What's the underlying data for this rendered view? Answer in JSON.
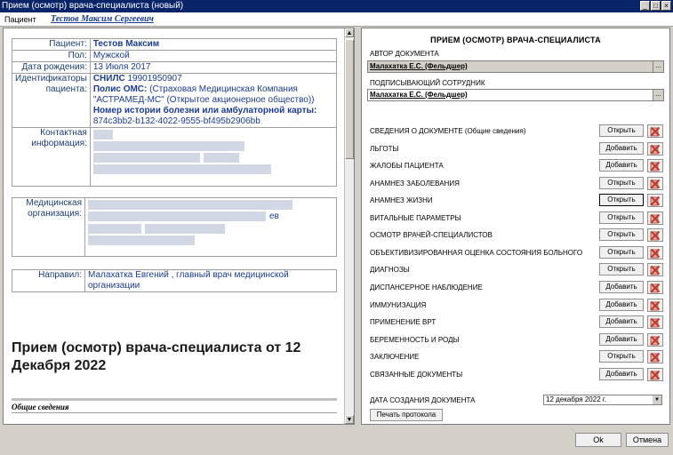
{
  "window": {
    "title": "Прием (осмотр) врача-специалиста (новый)",
    "controls": [
      "_",
      "□",
      "×"
    ]
  },
  "patient_bar": {
    "label": "Пациент",
    "name": "Тестов Максим Сергеевич"
  },
  "patient_card": {
    "patient_label": "Пациент:",
    "patient_value": "Тестов Максим",
    "sex_label": "Пол:",
    "sex_value": "Мужской",
    "dob_label": "Дата рождения:",
    "dob_value": "13 Июля 2017",
    "ids_label": "Идентификаторы пациента:",
    "snils_label": "СНИЛС",
    "snils_value": "19901950907",
    "oms_label": "Полис ОМС:",
    "oms_value": "(Страховая Медицинская Компания \"АСТРАМЕД-МС\" (Открытое акционерное общество))",
    "history_label": "Номер истории болезни или амбулаторной карты:",
    "history_value": "874c3bb2-b132-4022-9555-bf495b2906bb",
    "contact_label": "Контактная информация:",
    "org_label": "Медицинская организация:",
    "org_fragment": "ев",
    "referrer_label": "Направил:",
    "referrer_value": "Малахатка Евгений , главный врач медицинской организации"
  },
  "document": {
    "title": "Прием (осмотр) врача-специалиста от 12 Декабря 2022",
    "general_section": "Общие сведения"
  },
  "right_panel": {
    "header": "ПРИЕМ (ОСМОТР) ВРАЧА-СПЕЦИАЛИСТА",
    "author_label": "АВТОР ДОКУМЕНТА",
    "author_value": "Малахатка Е.С. (Фельдшер)",
    "signer_label": "ПОДПИСЫВАЮЩИЙ СОТРУДНИК",
    "signer_value": "Малахатка Е.С. (Фельдшер)",
    "ellipsis": "...",
    "sections": [
      {
        "label": "СВЕДЕНИЯ О ДОКУМЕНТЕ (Общие сведения)",
        "action": "Открыть"
      },
      {
        "label": "ЛЬГОТЫ",
        "action": "Добавить"
      },
      {
        "label": "ЖАЛОБЫ ПАЦИЕНТА",
        "action": "Добавить"
      },
      {
        "label": "АНАМНЕЗ ЗАБОЛЕВАНИЯ",
        "action": "Открыть"
      },
      {
        "label": "АНАМНЕЗ ЖИЗНИ",
        "action": "Открыть"
      },
      {
        "label": "ВИТАЛЬНЫЕ ПАРАМЕТРЫ",
        "action": "Открыть"
      },
      {
        "label": "ОСМОТР ВРАЧЕЙ-СПЕЦИАЛИСТОВ",
        "action": "Открыть"
      },
      {
        "label": "ОБЪЕКТИВИЗИРОВАННАЯ ОЦЕНКА СОСТОЯНИЯ БОЛЬНОГО",
        "action": "Открыть"
      },
      {
        "label": "ДИАГНОЗЫ",
        "action": "Открыть"
      },
      {
        "label": "ДИСПАНСЕРНОЕ НАБЛЮДЕНИЕ",
        "action": "Добавить"
      },
      {
        "label": "ИММУНИЗАЦИЯ",
        "action": "Добавить"
      },
      {
        "label": "ПРИМЕНЕНИЕ ВРТ",
        "action": "Добавить"
      },
      {
        "label": "БЕРЕМЕННОСТЬ И РОДЫ",
        "action": "Добавить"
      },
      {
        "label": "ЗАКЛЮЧЕНИЕ",
        "action": "Открыть"
      },
      {
        "label": "СВЯЗАННЫЕ ДОКУМЕНТЫ",
        "action": "Добавить"
      }
    ],
    "date_label": "ДАТА СОЗДАНИЯ ДОКУМЕНТА",
    "date_value": "12 декабря 2022 г.",
    "print_label": "Печать протокола"
  },
  "footer": {
    "ok_label": "Ok",
    "cancel_label": "Отмена"
  },
  "colors": {
    "title_bar": "#0a246a",
    "link_blue": "#1a3c9a",
    "delete_red": "#c0392b"
  }
}
